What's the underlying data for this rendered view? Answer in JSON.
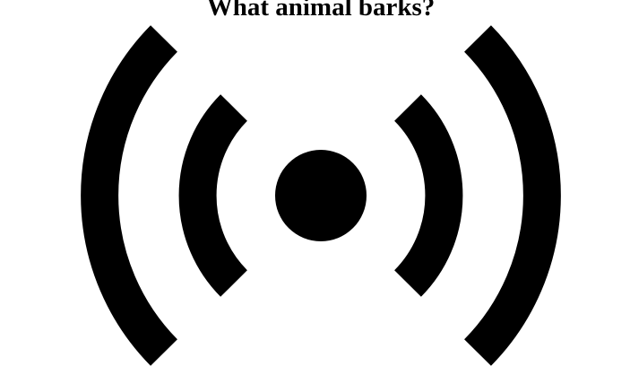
{
  "question": {
    "text": "What animal barks?"
  },
  "figure": {
    "icon": "broadcast-signal-icon",
    "color": "#000000",
    "background": "#ffffff"
  }
}
